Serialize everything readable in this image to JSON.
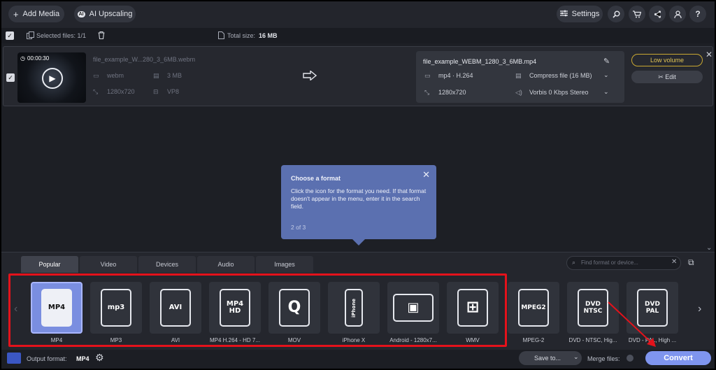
{
  "toolbar": {
    "add_media": "Add Media",
    "ai_upscaling": "AI Upscaling",
    "settings": "Settings",
    "add_icon": "+",
    "ai_icon": "AI"
  },
  "selection": {
    "selected_label": "Selected files: 1/1",
    "total_label": "Total size:",
    "total_value": "16 MB"
  },
  "file": {
    "duration": "00:00:30",
    "name": "file_example_W...280_3_6MB.webm",
    "format": "webm",
    "size": "3 MB",
    "resolution": "1280x720",
    "codec": "VP8"
  },
  "output": {
    "name": "file_example_WEBM_1280_3_6MB.mp4",
    "format": "mp4 · H.264",
    "compress": "Compress file (16 MB)",
    "resolution": "1280x720",
    "audio": "Vorbis 0 Kbps Stereo",
    "low_volume": "Low volume",
    "edit": "Edit"
  },
  "tooltip": {
    "title": "Choose a format",
    "body": "Click the icon for the format you need. If that format doesn't appear in the menu, enter it in the search field.",
    "step": "2 of 3"
  },
  "tabs": [
    "Popular",
    "Video",
    "Devices",
    "Audio",
    "Images"
  ],
  "search": {
    "placeholder": "Find format or device..."
  },
  "formats": [
    {
      "label": "MP4",
      "icon": "MP4"
    },
    {
      "label": "MP3",
      "icon": "mp3"
    },
    {
      "label": "AVI",
      "icon": "AVI"
    },
    {
      "label": "MP4 H.264 - HD 7...",
      "icon": "MP4 HD"
    },
    {
      "label": "MOV",
      "icon": "Q"
    },
    {
      "label": "iPhone X",
      "icon": "iPhone"
    },
    {
      "label": "Android - 1280x7...",
      "icon": "▣"
    },
    {
      "label": "WMV",
      "icon": "⊞"
    },
    {
      "label": "MPEG-2",
      "icon": "MPEG2"
    },
    {
      "label": "DVD - NTSC, Hig...",
      "icon": "DVD NTSC"
    },
    {
      "label": "DVD - PAL, High ...",
      "icon": "DVD PAL"
    }
  ],
  "bottom": {
    "output_label": "Output format:",
    "output_value": "MP4",
    "save_to": "Save to...",
    "merge": "Merge files:",
    "convert": "Convert"
  },
  "colors": {
    "accent": "#7f95ef",
    "highlight": "#e4121b",
    "tooltip": "#5b70b0"
  }
}
